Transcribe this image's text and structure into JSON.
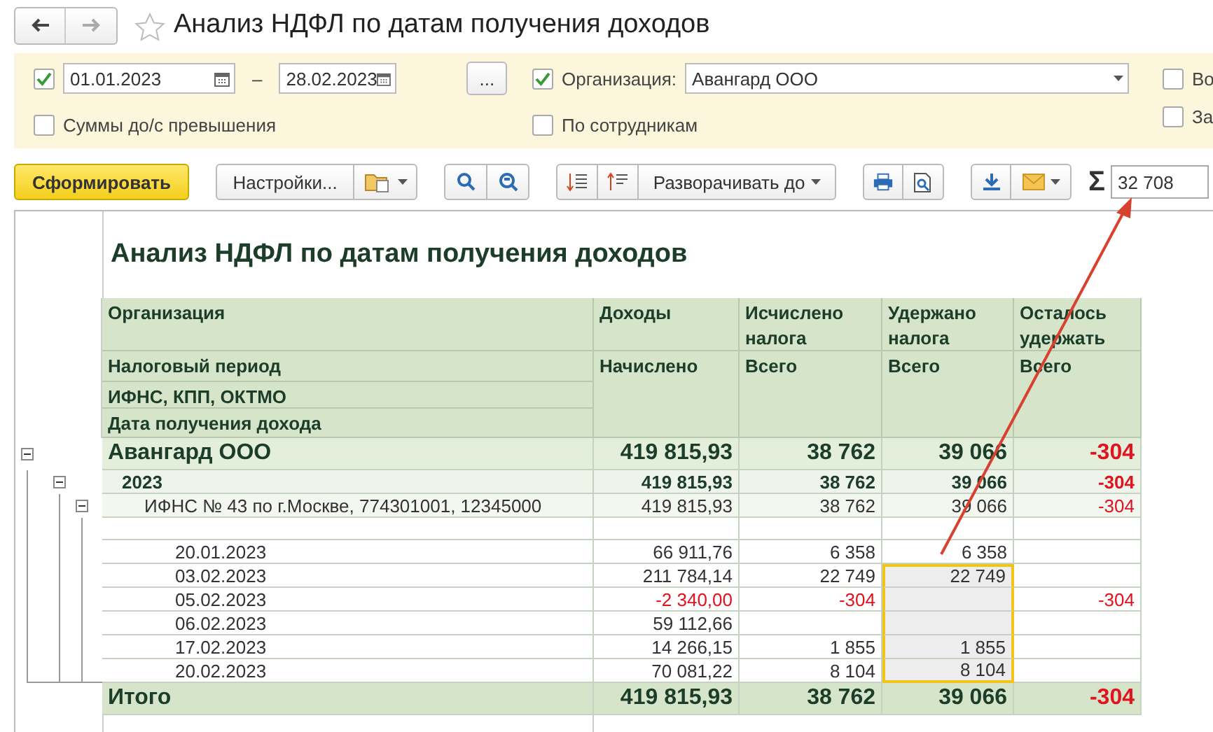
{
  "window": {
    "title": "Анализ НДФЛ по датам получения доходов",
    "favorite": false
  },
  "filters": {
    "period": {
      "checked": true,
      "date_from": "01.01.2023",
      "dash": "–",
      "date_to": "28.02.2023",
      "more_button": "..."
    },
    "organization": {
      "checked": true,
      "label": "Организация:",
      "value": "Авангард ООО"
    },
    "options": [
      {
        "label": "Суммы до/с превышения",
        "checked": false
      },
      {
        "label": "По сотрудникам",
        "checked": false
      },
      {
        "label": "Во",
        "checked": false
      },
      {
        "label": "За",
        "checked": false
      }
    ]
  },
  "toolbar": {
    "generate": "Сформировать",
    "settings": "Настройки...",
    "expand": "Разворачивать до",
    "sum_symbol": "Σ",
    "sum_value": "32 708"
  },
  "report": {
    "title": "Анализ НДФЛ по датам получения доходов",
    "groupings": [
      "Организация",
      "Налоговый период",
      "ИФНС, КПП, ОКТМО",
      "Дата получения дохода"
    ],
    "columns": [
      {
        "title": "Доходы",
        "sub": "Начислено"
      },
      {
        "title": "Исчислено налога",
        "sub": "Всего"
      },
      {
        "title": "Удержано налога",
        "sub": "Всего"
      },
      {
        "title": "Осталось удержать",
        "sub": "Всего"
      }
    ],
    "rows": [
      {
        "kind": "org",
        "label": "Авангард ООО",
        "expanded": true,
        "values": {
          "income": {
            "text": "419 815,93"
          },
          "calculated": {
            "text": "38 762"
          },
          "withheld": {
            "text": "39 066"
          },
          "remaining": {
            "text": "-304",
            "negative": true
          }
        },
        "children": [
          {
            "kind": "year",
            "label": "2023",
            "expanded": true,
            "values": {
              "income": {
                "text": "419 815,93"
              },
              "calculated": {
                "text": "38 762"
              },
              "withheld": {
                "text": "39 066"
              },
              "remaining": {
                "text": "-304",
                "negative": true
              }
            },
            "children": [
              {
                "kind": "office",
                "label": "ИФНС № 43 по г.Москве, 774301001, 12345000",
                "expanded": true,
                "values": {
                  "income": {
                    "text": "419 815,93"
                  },
                  "calculated": {
                    "text": "38 762"
                  },
                  "withheld": {
                    "text": "39 066"
                  },
                  "remaining": {
                    "text": "-304",
                    "negative": true
                  }
                },
                "children": [
                  {
                    "kind": "blank"
                  },
                  {
                    "kind": "date",
                    "label": "20.01.2023",
                    "values": {
                      "income": {
                        "text": "66 911,76"
                      },
                      "calculated": {
                        "text": "6 358"
                      },
                      "withheld": {
                        "text": "6 358"
                      }
                    }
                  },
                  {
                    "kind": "date",
                    "label": "03.02.2023",
                    "values": {
                      "income": {
                        "text": "211 784,14"
                      },
                      "calculated": {
                        "text": "22 749"
                      },
                      "withheld": {
                        "text": "22 749",
                        "selected": true
                      }
                    }
                  },
                  {
                    "kind": "date",
                    "label": "05.02.2023",
                    "values": {
                      "income": {
                        "text": "-2 340,00",
                        "negative": true
                      },
                      "calculated": {
                        "text": "-304",
                        "negative": true
                      },
                      "withheld": {
                        "selected": true
                      },
                      "remaining": {
                        "text": "-304",
                        "negative": true
                      }
                    }
                  },
                  {
                    "kind": "date",
                    "label": "06.02.2023",
                    "values": {
                      "income": {
                        "text": "59 112,66"
                      },
                      "withheld": {
                        "selected": true
                      }
                    }
                  },
                  {
                    "kind": "date",
                    "label": "17.02.2023",
                    "values": {
                      "income": {
                        "text": "14 266,15"
                      },
                      "calculated": {
                        "text": "1 855"
                      },
                      "withheld": {
                        "text": "1 855",
                        "selected": true
                      }
                    }
                  },
                  {
                    "kind": "date",
                    "label": "20.02.2023",
                    "values": {
                      "income": {
                        "text": "70 081,22"
                      },
                      "calculated": {
                        "text": "8 104"
                      },
                      "withheld": {
                        "text": "8 104",
                        "selected": true
                      }
                    }
                  }
                ]
              }
            ]
          }
        ]
      }
    ],
    "total": {
      "label": "Итого",
      "values": {
        "income": {
          "text": "419 815,93"
        },
        "calculated": {
          "text": "38 762"
        },
        "withheld": {
          "text": "39 066"
        },
        "remaining": {
          "text": "-304",
          "negative": true
        }
      }
    }
  }
}
